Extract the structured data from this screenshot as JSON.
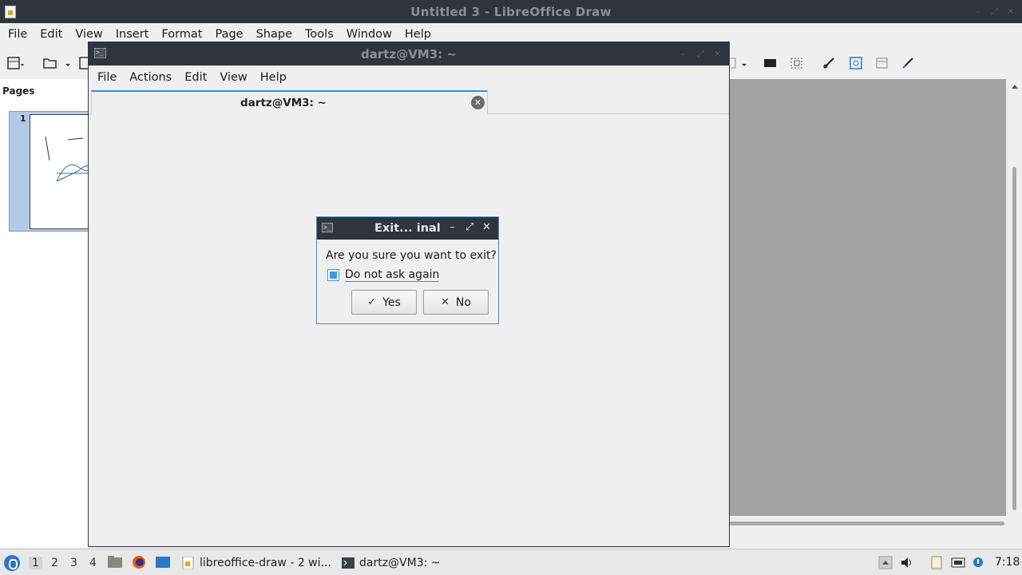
{
  "libreoffice": {
    "window_title": "Untitled 3 - LibreOffice Draw",
    "menu": [
      "File",
      "Edit",
      "View",
      "Insert",
      "Format",
      "Page",
      "Shape",
      "Tools",
      "Window",
      "Help"
    ],
    "pages_panel_label": "Pages",
    "page_number": "1"
  },
  "terminal": {
    "window_title": "dartz@VM3: ~",
    "menu": [
      "File",
      "Actions",
      "Edit",
      "View",
      "Help"
    ],
    "tab_label": "dartz@VM3: ~"
  },
  "dialog": {
    "title": "Exit... inal",
    "message": "Are you sure you want to exit?",
    "checkbox_label": "Do not ask again",
    "checkbox_checked": true,
    "yes_label": "Yes",
    "no_label": "No"
  },
  "taskbar": {
    "workspaces": [
      "1",
      "2",
      "3",
      "4"
    ],
    "active_workspace": "1",
    "tasks": [
      {
        "label": "libreoffice-draw - 2 wi...",
        "icon": "libreoffice-draw-icon"
      },
      {
        "label": "dartz@VM3: ~",
        "icon": "terminal-icon"
      }
    ],
    "clock": "7:18"
  },
  "colors": {
    "titlebar": "#2f343f",
    "accent": "#3d8ee0",
    "canvas": "#a3a3a3"
  }
}
